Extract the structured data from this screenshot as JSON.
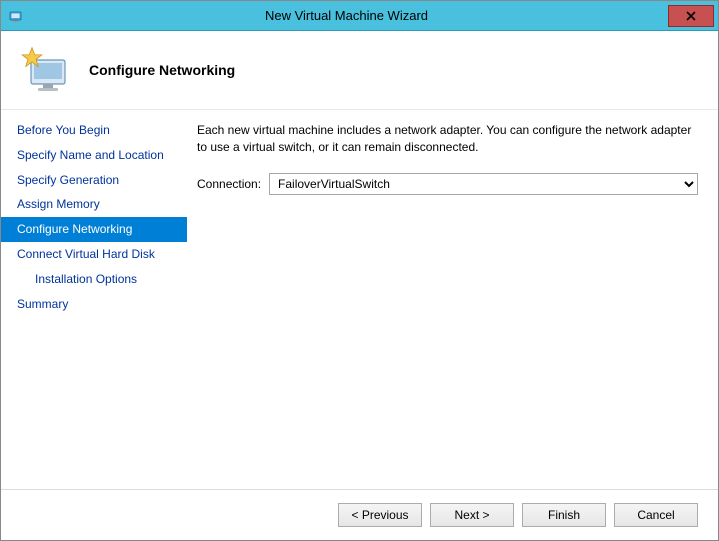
{
  "window": {
    "title": "New Virtual Machine Wizard"
  },
  "header": {
    "title": "Configure Networking"
  },
  "nav": {
    "items": [
      {
        "label": "Before You Begin",
        "selected": false,
        "sub": false
      },
      {
        "label": "Specify Name and Location",
        "selected": false,
        "sub": false
      },
      {
        "label": "Specify Generation",
        "selected": false,
        "sub": false
      },
      {
        "label": "Assign Memory",
        "selected": false,
        "sub": false
      },
      {
        "label": "Configure Networking",
        "selected": true,
        "sub": false
      },
      {
        "label": "Connect Virtual Hard Disk",
        "selected": false,
        "sub": false
      },
      {
        "label": "Installation Options",
        "selected": false,
        "sub": true
      },
      {
        "label": "Summary",
        "selected": false,
        "sub": false
      }
    ]
  },
  "content": {
    "description": "Each new virtual machine includes a network adapter. You can configure the network adapter to use a virtual switch, or it can remain disconnected.",
    "connection_label": "Connection:",
    "connection_value": "FailoverVirtualSwitch"
  },
  "footer": {
    "previous": "< Previous",
    "next": "Next >",
    "finish": "Finish",
    "cancel": "Cancel"
  }
}
